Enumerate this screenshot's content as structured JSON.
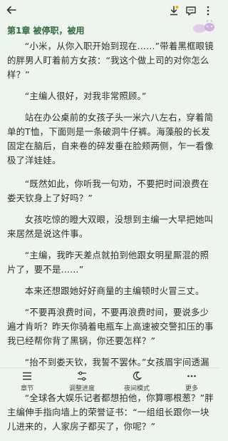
{
  "header": {
    "icons": [
      "back-arrow-icon",
      "download-icon",
      "comment-icon",
      "more-vertical-icon"
    ]
  },
  "chapter": {
    "title": "第1章 被停职，被用"
  },
  "paragraphs": [
    "“小米，从你入职开始到现在……”带着黑框眼镜的胖男人盯着前方女孩：“我这个做上司的对你怎么样？”",
    "“主编人很好，对我非常照顾。”",
    "站在办公桌前的女孩子头一米六八左右，穿着简单的T恤，下面则是一条破洞牛仔裤。海藻般的长发固定在脑后，自来卷的碎发垂在脸颊两侧，乍一看像极了洋娃娃。",
    "“既然如此，你听我一句劝，不要把时间浪费在娄天钦身上了好吗？”",
    "女孩吃惊的瞪大双眼，没想到主编一大早把她叫来居然是说这件事。",
    "“主编，我昨天差点就拍到他跟女明星厮混的照片了，要不是……”",
    "本来还想跟她好好商量的主编顿时火冒三丈。",
    "“不要再浪费时间，不要再浪费时间，要说多少遍才肯听？昨天你骑着电瓶车上高速被交警扣压的事我已经帮你背了黑锅，你还要怎样？”",
    "“抬不到娄天钦，我誓不罢休。”女孩眉宇间透漏出一股与性格不符合的坚定信念。",
    "“全球各大娱乐记者都想拍他，你算哪根葱？”胖主编伸手指向墙上的荣誉证书：“一组组长跟你一块儿进来的，人家房子都买了，你呢？”"
  ],
  "bottom_nav": [
    {
      "icon": "list-icon",
      "label": "章节"
    },
    {
      "icon": "progress-icon",
      "label": "调整进度"
    },
    {
      "icon": "moon-icon",
      "label": "夜间模式"
    },
    {
      "icon": "more-dots-icon",
      "label": "更多"
    }
  ],
  "colors": {
    "background": "#eef4ee",
    "title": "#2f6b3c",
    "text": "#2c2f2c"
  }
}
